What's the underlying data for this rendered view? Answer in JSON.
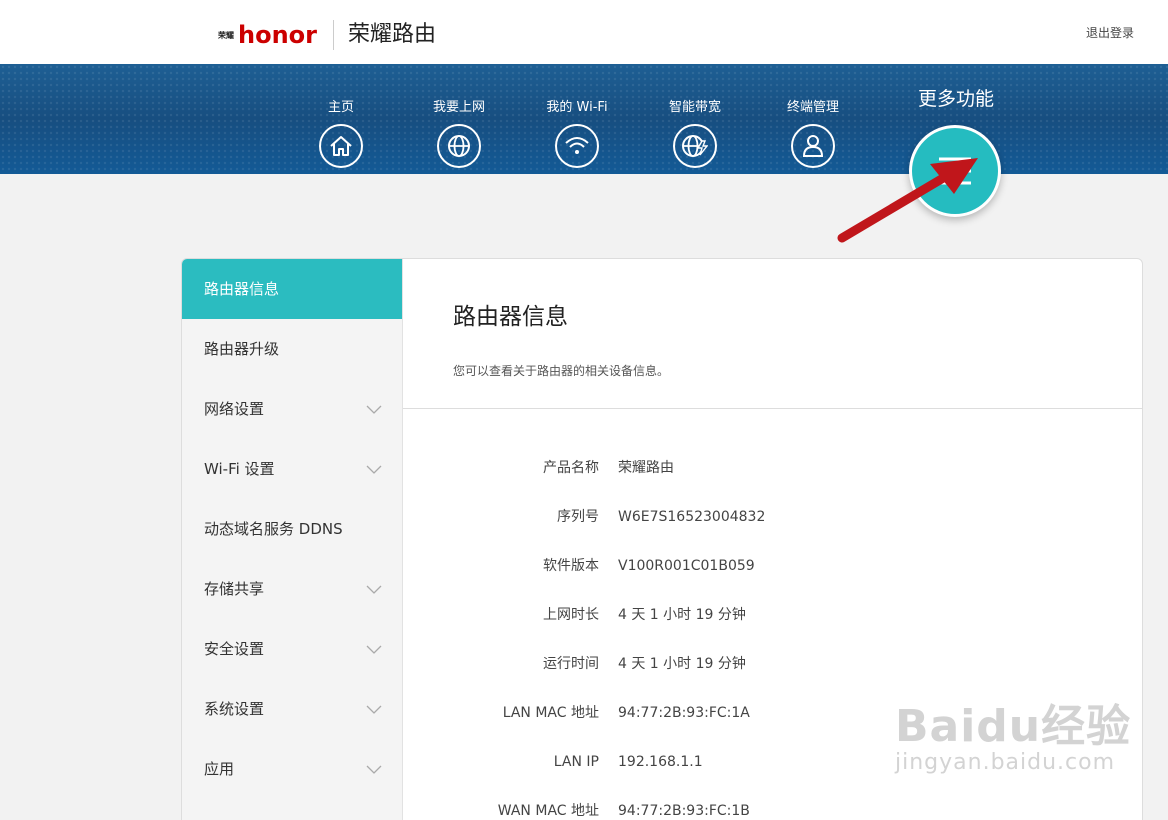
{
  "header": {
    "brand_mark": "荣耀",
    "brand_logo_text": "honor",
    "brand_title": "荣耀路由",
    "logout_label": "退出登录"
  },
  "nav": {
    "items": [
      {
        "label": "主页",
        "icon": "home-icon"
      },
      {
        "label": "我要上网",
        "icon": "globe-icon"
      },
      {
        "label": "我的 Wi-Fi",
        "icon": "wifi-icon"
      },
      {
        "label": "智能带宽",
        "icon": "globe-bolt-icon"
      },
      {
        "label": "终端管理",
        "icon": "user-icon"
      }
    ],
    "more_label": "更多功能",
    "more_icon": "menu-icon"
  },
  "sidebar": {
    "items": [
      {
        "label": "路由器信息",
        "active": true,
        "expandable": false
      },
      {
        "label": "路由器升级",
        "active": false,
        "expandable": false
      },
      {
        "label": "网络设置",
        "active": false,
        "expandable": true
      },
      {
        "label": "Wi-Fi 设置",
        "active": false,
        "expandable": true
      },
      {
        "label": "动态域名服务 DDNS",
        "active": false,
        "expandable": false
      },
      {
        "label": "存储共享",
        "active": false,
        "expandable": true
      },
      {
        "label": "安全设置",
        "active": false,
        "expandable": true
      },
      {
        "label": "系统设置",
        "active": false,
        "expandable": true
      },
      {
        "label": "应用",
        "active": false,
        "expandable": true
      }
    ]
  },
  "content": {
    "title": "路由器信息",
    "description": "您可以查看关于路由器的相关设备信息。",
    "rows": [
      {
        "label": "产品名称",
        "value": "荣耀路由"
      },
      {
        "label": "序列号",
        "value": "W6E7S16523004832"
      },
      {
        "label": "软件版本",
        "value": "V100R001C01B059"
      },
      {
        "label": "上网时长",
        "value": "4 天 1 小时 19 分钟"
      },
      {
        "label": "运行时间",
        "value": "4 天 1 小时 19 分钟"
      },
      {
        "label": "LAN MAC 地址",
        "value": "94:77:2B:93:FC:1A"
      },
      {
        "label": "LAN IP",
        "value": "192.168.1.1"
      },
      {
        "label": "WAN MAC 地址",
        "value": "94:77:2B:93:FC:1B"
      }
    ]
  },
  "watermark": {
    "main": "Baidu经验",
    "sub": "jingyan.baidu.com"
  },
  "colors": {
    "accent": "#2bbcc0",
    "nav_bg": "#174e80",
    "annotation_arrow": "#c0161b"
  }
}
